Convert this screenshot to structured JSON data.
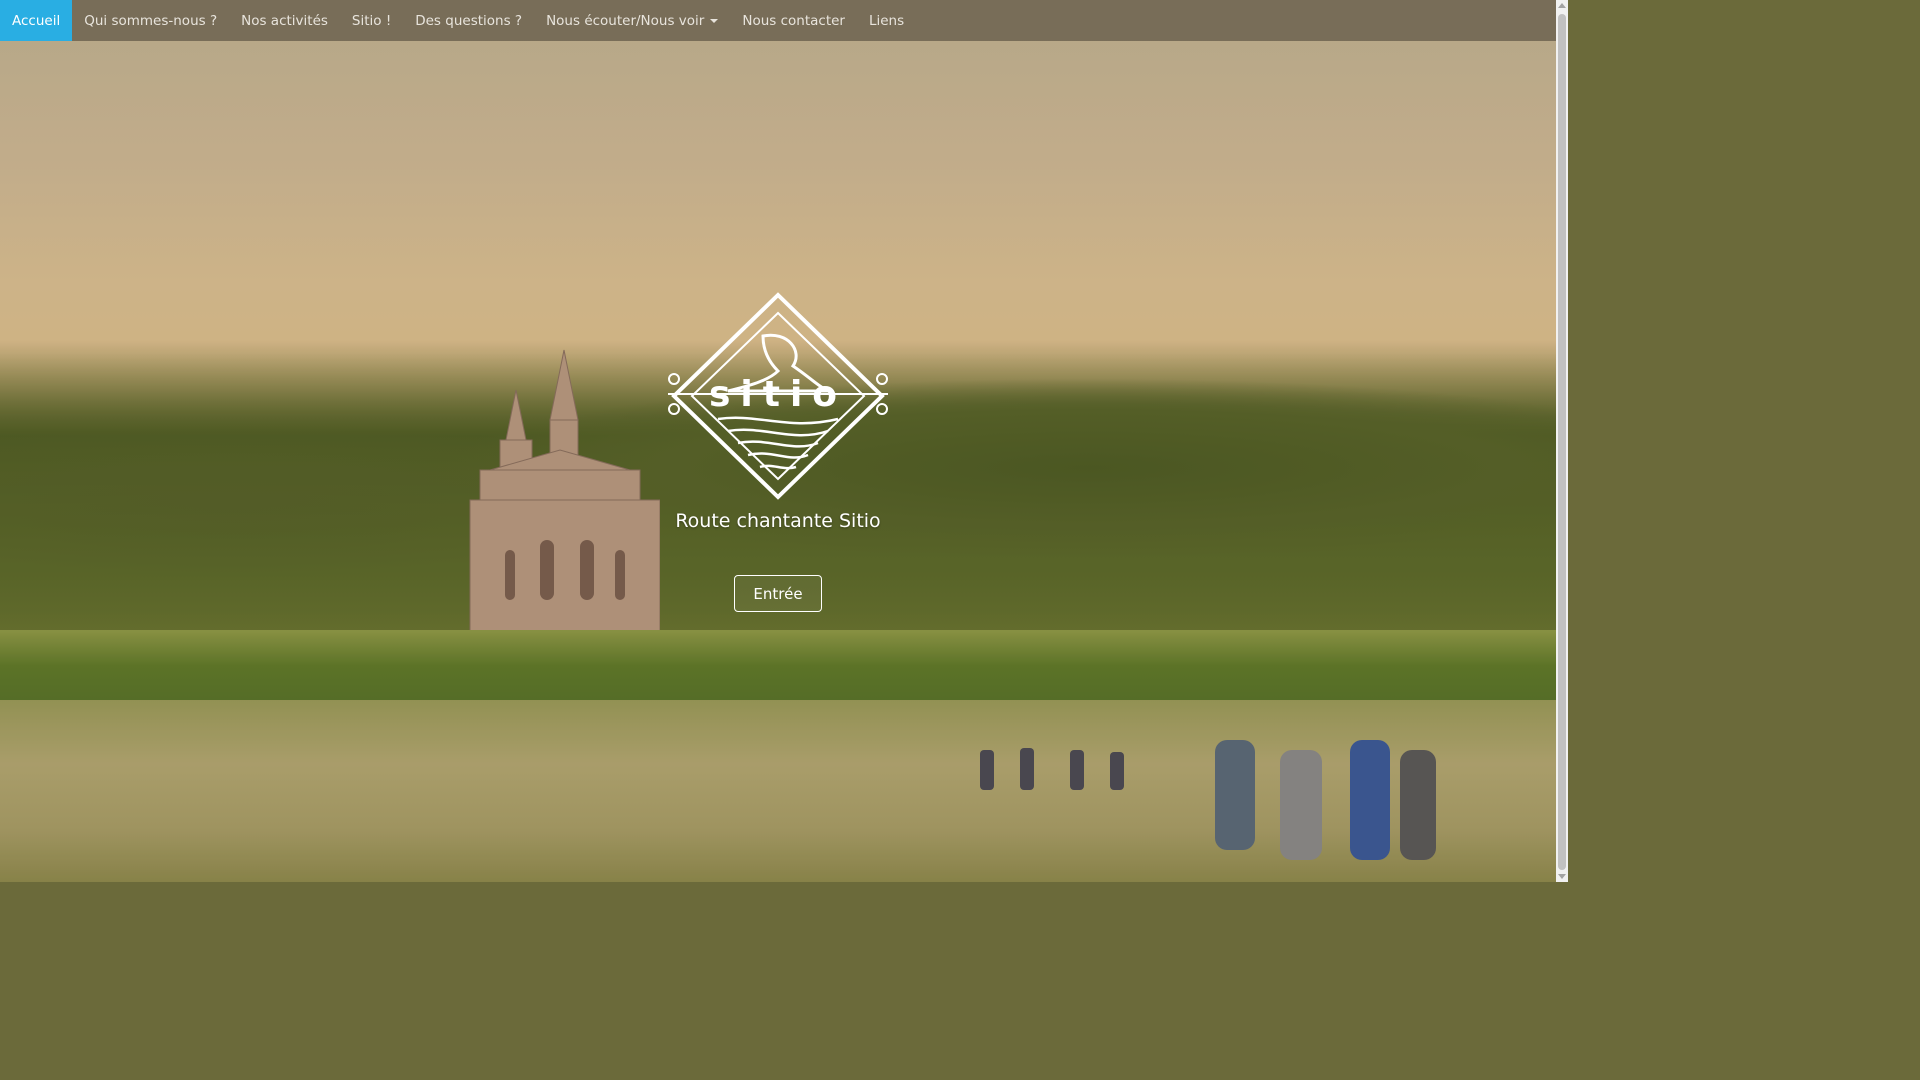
{
  "nav": {
    "items": [
      {
        "label": "Accueil",
        "active": true
      },
      {
        "label": "Qui sommes-nous ?"
      },
      {
        "label": "Nos activités"
      },
      {
        "label": "Sitio !"
      },
      {
        "label": "Des questions ?"
      },
      {
        "label": "Nous écouter/Nous voir",
        "dropdown": true
      },
      {
        "label": "Nous contacter"
      },
      {
        "label": "Liens"
      }
    ],
    "active_color": "#29aee3"
  },
  "hero": {
    "logo_text": "sitio",
    "tagline": "Route chantante Sitio",
    "enter_label": "Entrée"
  }
}
